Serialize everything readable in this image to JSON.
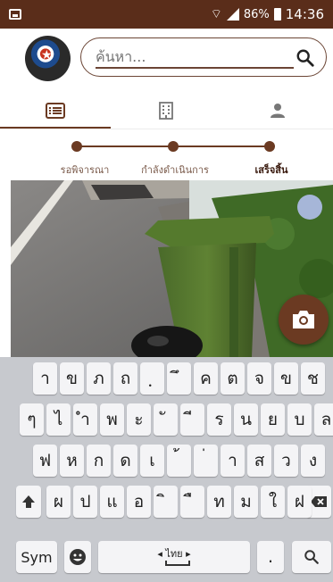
{
  "status_bar": {
    "battery": "86%",
    "time": "14:36"
  },
  "search": {
    "placeholder": "ค้นหา..."
  },
  "tabs": [
    {
      "icon": "list-icon",
      "active": true
    },
    {
      "icon": "building-icon",
      "active": false
    },
    {
      "icon": "person-icon",
      "active": false
    }
  ],
  "steps": [
    {
      "label": "รอพิจารณา"
    },
    {
      "label": "กำลังดำเนินการ"
    },
    {
      "label": "เสร็จสิ้น",
      "current": true
    }
  ],
  "keyboard": {
    "row1": [
      "า",
      "ข",
      "ภ",
      "ถ",
      "ฺ",
      "ึ",
      "ค",
      "ต",
      "จ",
      "ข",
      "ช"
    ],
    "row2": [
      "ๆ",
      "ไ",
      "ำ",
      "พ",
      "ะ",
      "ั",
      "ี",
      "ร",
      "น",
      "ย",
      "บ",
      "ล"
    ],
    "row3": [
      "ฟ",
      "ห",
      "ก",
      "ด",
      "เ",
      "้",
      "่",
      "า",
      "ส",
      "ว",
      "ง"
    ],
    "row4": [
      "ผ",
      "ป",
      "แ",
      "อ",
      "ิ",
      "ื",
      "ท",
      "ม",
      "ใ",
      "ฝ"
    ],
    "sym_label": "Sym",
    "space_label": "◂ ไทย ▸"
  },
  "colors": {
    "brand": "#6b3a22",
    "statusbar": "#5a2d1a",
    "keyboard_bg": "#c7c9ce"
  }
}
